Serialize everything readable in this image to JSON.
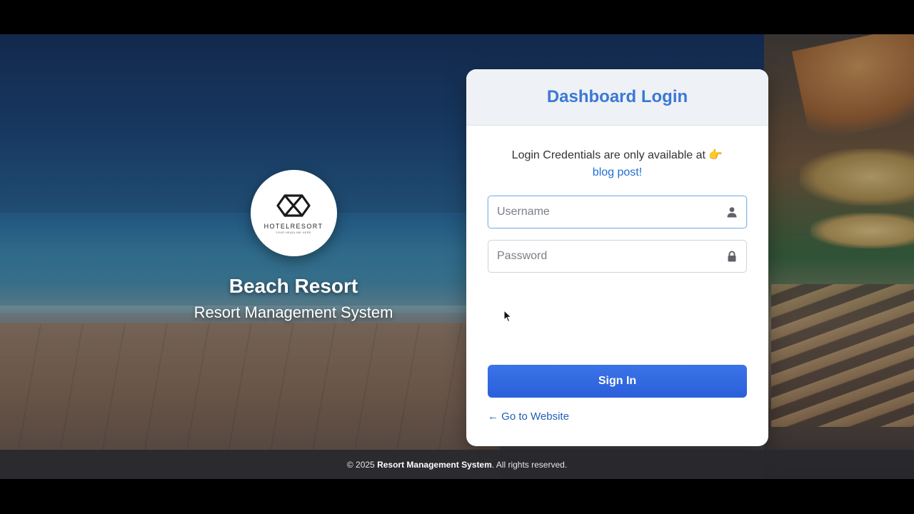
{
  "brand": {
    "logo_text": "HOTELRESORT",
    "logo_tagline": "YOUR HEADLINE HERE",
    "name": "Beach Resort",
    "subtitle": "Resort Management System"
  },
  "login": {
    "title": "Dashboard Login",
    "notice_text": "Login Credentials are only available at 👉",
    "notice_link": "blog post!",
    "username_placeholder": "Username",
    "username_value": "",
    "password_placeholder": "Password",
    "password_value": "",
    "signin_label": "Sign In",
    "back_link": "← Go to Website"
  },
  "footer": {
    "prefix": "© 2025",
    "system_name": "Resort Management System",
    "suffix": ". All rights reserved."
  },
  "colors": {
    "title_blue": "#3a78d6",
    "button_blue": "#2f66e0",
    "link_blue": "#1f6fd1"
  },
  "icons": [
    "user-icon",
    "lock-icon",
    "logo-mark-icon"
  ]
}
